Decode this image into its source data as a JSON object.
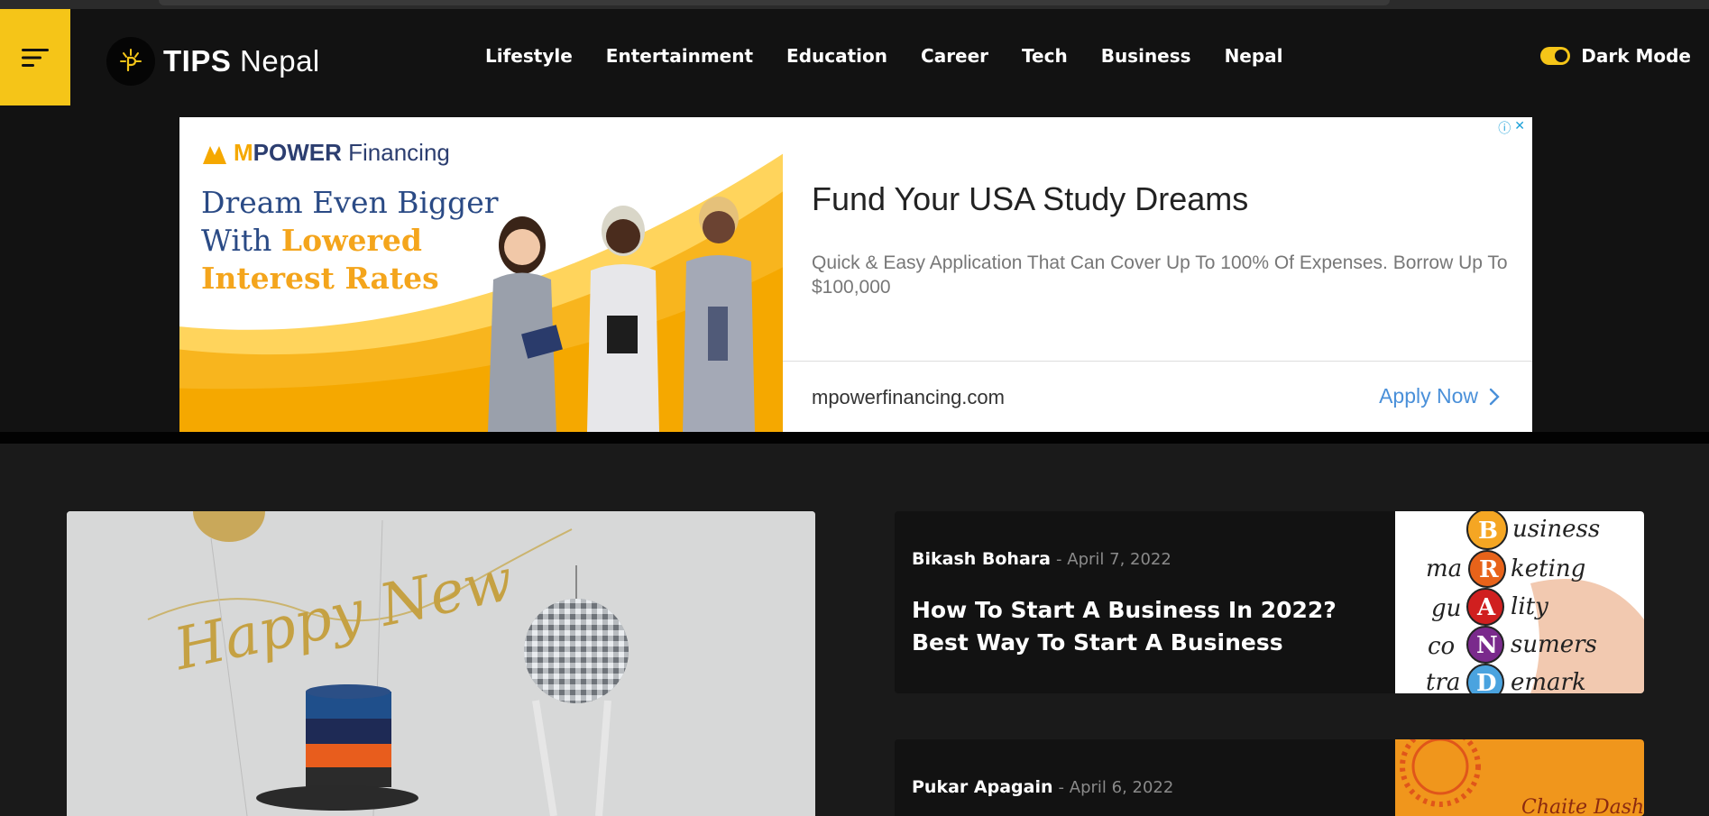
{
  "site": {
    "logo_bold": "TIPS",
    "logo_light": "Nepal"
  },
  "nav": {
    "items": [
      "Lifestyle",
      "Entertainment",
      "Education",
      "Career",
      "Tech",
      "Business",
      "Nepal"
    ]
  },
  "theme_toggle": {
    "label": "Dark Mode",
    "state": "on",
    "accent": "#f5c518"
  },
  "ad": {
    "brand_prefix": "M",
    "brand_bold": "POWER",
    "brand_rest": "Financing",
    "headline_line1": "Dream Even Bigger",
    "headline_line2_prefix": "With ",
    "headline_line2_highlight": "Lowered",
    "headline_line3": "Interest Rates",
    "title": "Fund Your USA Study Dreams",
    "description": "Quick & Easy Application That Can Cover Up To 100% Of Expenses. Borrow Up To $100,000",
    "domain": "mpowerfinancing.com",
    "cta": "Apply Now"
  },
  "posts": [
    {
      "author": "Bikash Bohara",
      "date": "April 7, 2022",
      "title": "How To Start A Business In 2022? Best Way To Start A Business",
      "thumb_words": [
        "usiness",
        "ma",
        "keting",
        "gu",
        "lity",
        "co",
        "sumers",
        "tra",
        "emark"
      ],
      "thumb_letters": [
        "B",
        "R",
        "A",
        "N",
        "D"
      ]
    },
    {
      "author": "Pukar Apagain",
      "date": "April 6, 2022",
      "thumb_caption": "Chaite Dashain"
    }
  ],
  "hero": {
    "banner_text": "Happy New"
  }
}
